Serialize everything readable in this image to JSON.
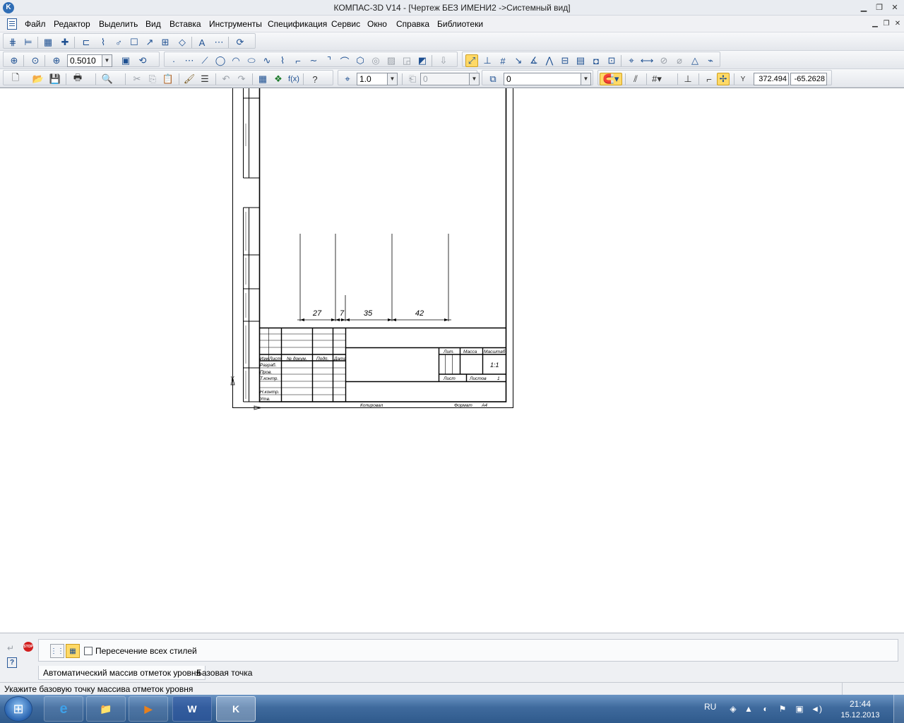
{
  "window": {
    "title": "КОМПАС-3D V14 - [Чертеж БЕЗ ИМЕНИ2 ->Системный вид]"
  },
  "menu": {
    "items": [
      "Файл",
      "Редактор",
      "Выделить",
      "Вид",
      "Вставка",
      "Инструменты",
      "Спецификация",
      "Сервис",
      "Окно",
      "Справка",
      "Библиотеки"
    ]
  },
  "toolbar": {
    "zoom_value": "0.5010",
    "step_value": "1.0",
    "angle_value": "0",
    "layer_value": "0",
    "coord_x": "372.494",
    "coord_y": "-65.2628",
    "coord_label": "Y"
  },
  "drawing": {
    "dimensions": [
      "27",
      "7",
      "35",
      "42"
    ],
    "title_block": {
      "cells": [
        "Изм",
        "Лист",
        "№ докум.",
        "Подп.",
        "Дата",
        "Разраб.",
        "Пров.",
        "Т.контр.",
        "Н.контр.",
        "Утв.",
        "Лит.",
        "Масса",
        "Масштаб",
        "1:1",
        "Лист",
        "Листов",
        "1"
      ],
      "footer_left": "Копировал",
      "footer_right_label": "Формат",
      "footer_right_value": "A4"
    },
    "origin_label": "Y"
  },
  "property_panel": {
    "checkbox_label": "Пересечение всех стилей",
    "tabs": [
      "Автоматический массив отметок уровня",
      "Базовая точка"
    ],
    "stop_label": "STOP"
  },
  "status": {
    "text": "Укажите базовую точку массива отметок уровня"
  },
  "taskbar": {
    "language": "RU",
    "time": "21:44",
    "date": "15.12.2013"
  }
}
